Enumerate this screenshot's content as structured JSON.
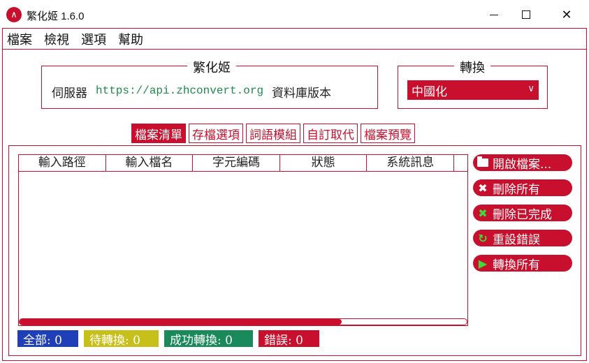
{
  "window": {
    "icon_glyph": "∧",
    "title": "繁化姬 1.6.0",
    "minimize_glyph": "",
    "maximize_glyph": "",
    "close_glyph": "✕"
  },
  "menu": [
    "檔案",
    "檢視",
    "選項",
    "幫助"
  ],
  "server_group": {
    "title": "繁化姬",
    "server_label": "伺服器",
    "server_url": "https://api.zhconvert.org",
    "db_version_label": "資料庫版本"
  },
  "convert_group": {
    "title": "轉換",
    "selected": "中國化",
    "arrow": "∨"
  },
  "tabs": [
    {
      "label": "檔案清單",
      "active": true
    },
    {
      "label": "存檔選項",
      "active": false
    },
    {
      "label": "詞語模組",
      "active": false
    },
    {
      "label": "自訂取代",
      "active": false
    },
    {
      "label": "檔案預覽",
      "active": false
    }
  ],
  "table": {
    "columns": [
      "輸入路徑",
      "輸入檔名",
      "字元編碼",
      "狀態",
      "系統訊息"
    ],
    "rows": [],
    "scroll_fraction": 0.72
  },
  "actions": {
    "open_files": "開啟檔案...",
    "delete_all": "刪除所有",
    "delete_completed": "刪除已完成",
    "reset_errors": "重設錯誤",
    "convert_all": "轉換所有"
  },
  "icons": {
    "delete_all": "✖",
    "delete_completed": "✖",
    "reset_errors": "↻",
    "convert_all": "▶"
  },
  "status": {
    "all": "全部: 0",
    "pending": "待轉換: 0",
    "success": "成功轉換: 0",
    "error": "錯誤: 0"
  },
  "colors": {
    "accent": "#c8102e",
    "all": "#1f3fb8",
    "pending": "#c8c01a",
    "success": "#1b8a5a",
    "error": "#c8102e",
    "url": "#1e8a4a",
    "icon_green": "#3ddc3a"
  }
}
